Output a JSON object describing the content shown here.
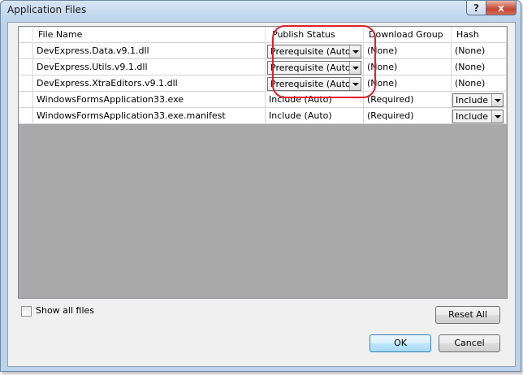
{
  "window": {
    "title": "Application Files"
  },
  "title_buttons": {
    "help": "?",
    "close": "x"
  },
  "columns": [
    "File Name",
    "Publish Status",
    "Download Group",
    "Hash"
  ],
  "rows": [
    {
      "name": "DevExpress.Data.v9.1.dll",
      "status": "Prerequisite (Auto)",
      "status_is_combo": true,
      "group": "(None)",
      "hash": "(None)",
      "hash_is_combo": false
    },
    {
      "name": "DevExpress.Utils.v9.1.dll",
      "status": "Prerequisite (Auto)",
      "status_is_combo": true,
      "group": "(None)",
      "hash": "(None)",
      "hash_is_combo": false
    },
    {
      "name": "DevExpress.XtraEditors.v9.1.dll",
      "status": "Prerequisite (Auto)",
      "status_is_combo": true,
      "group": "(None)",
      "hash": "(None)",
      "hash_is_combo": false
    },
    {
      "name": "WindowsFormsApplication33.exe",
      "status": "Include (Auto)",
      "status_is_combo": false,
      "group": "(Required)",
      "hash": "Include",
      "hash_is_combo": true
    },
    {
      "name": "WindowsFormsApplication33.exe.manifest",
      "status": "Include (Auto)",
      "status_is_combo": false,
      "group": "(Required)",
      "hash": "Include",
      "hash_is_combo": true
    }
  ],
  "show_all_files": {
    "label": "Show all files",
    "checked": false
  },
  "buttons": {
    "reset_all": "Reset All",
    "ok": "OK",
    "cancel": "Cancel"
  },
  "colors": {
    "highlight": "#e2202a",
    "grid_empty": "#a9a9a9",
    "window_frame": "#bcd3ea"
  }
}
